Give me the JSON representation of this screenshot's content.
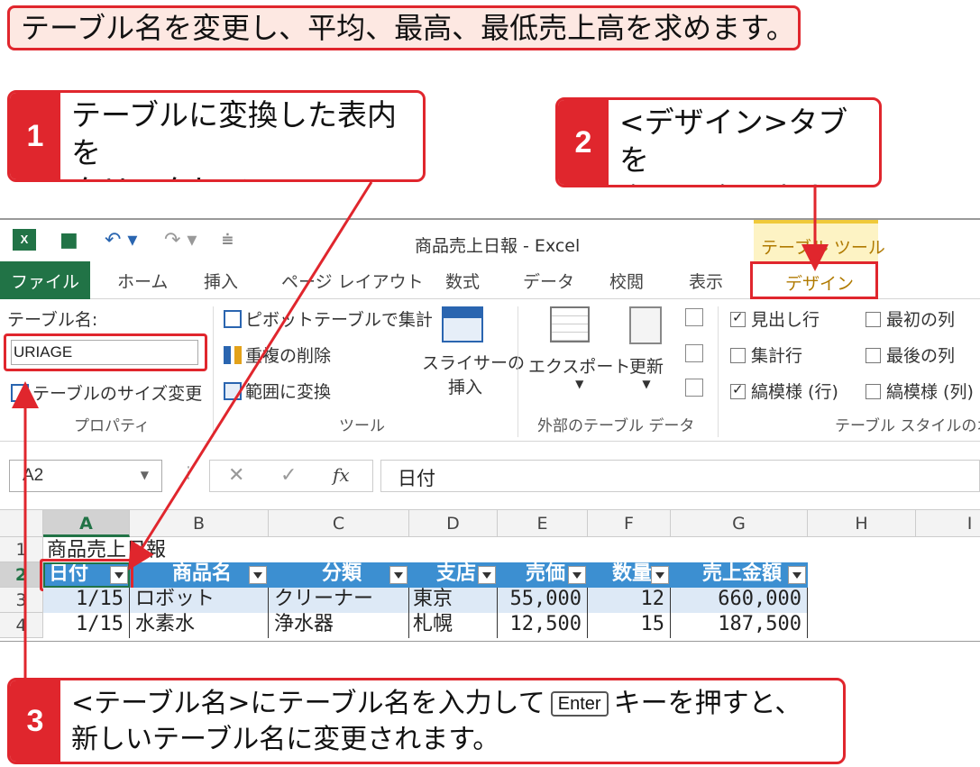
{
  "heading": "テーブル名を変更し、平均、最高、最低売上高を求めます。",
  "callouts": [
    {
      "num": "1",
      "text": "テーブルに変換した表内を\nクリックして、"
    },
    {
      "num": "2",
      "text": "<デザイン>タブを\nクリックします。"
    },
    {
      "num": "3",
      "text_before": "<テーブル名>にテーブル名を入力して",
      "key": "Enter",
      "text_after": "キーを押すと、\n新しいテーブル名に変更されます。"
    }
  ],
  "window": {
    "title": "商品売上日報 - Excel",
    "context_tab_group": "テーブル ツール",
    "tabs": [
      "ファイル",
      "ホーム",
      "挿入",
      "ページ レイアウト",
      "数式",
      "データ",
      "校閲",
      "表示",
      "デザイン"
    ]
  },
  "ribbon": {
    "table_name_label": "テーブル名:",
    "table_name_value": "URIAGE",
    "resize_table": "テーブルのサイズ変更",
    "group_properties": "プロパティ",
    "pivot": "ピボットテーブルで集計",
    "remove_duplicates": "重複の削除",
    "convert_range": "範囲に変換",
    "slicer_line1": "スライサーの",
    "slicer_line2": "挿入",
    "group_tools": "ツール",
    "export": "エクスポート",
    "refresh": "更新",
    "group_external": "外部のテーブル データ",
    "opt_header_row": "見出し行",
    "opt_total_row": "集計行",
    "opt_banded_rows": "縞模様 (行)",
    "opt_first_col": "最初の列",
    "opt_last_col": "最後の列",
    "opt_banded_cols": "縞模様 (列)",
    "group_style_options": "テーブル スタイルのオ",
    "header_row_checked": true,
    "total_row_checked": false,
    "banded_rows_checked": true,
    "first_col_checked": false,
    "last_col_checked": false,
    "banded_cols_checked": false
  },
  "formula_bar": {
    "name_box": "A2",
    "fx": "fx",
    "content": "日付"
  },
  "sheet": {
    "columns": [
      "A",
      "B",
      "C",
      "D",
      "E",
      "F",
      "G",
      "H",
      "I"
    ],
    "rows": [
      "1",
      "2",
      "3",
      "4"
    ],
    "title": "商品売上日報",
    "headers": [
      "日付",
      "商品名",
      "分類",
      "支店",
      "売価",
      "数量",
      "売上金額"
    ],
    "data": [
      [
        "1/15",
        "ロボット",
        "クリーナー",
        "東京",
        "55,000",
        "12",
        "660,000"
      ],
      [
        "1/15",
        "水素水",
        "浄水器",
        "札幌",
        "12,500",
        "15",
        "187,500"
      ]
    ]
  },
  "colors": {
    "accent": "#e0262d",
    "excel_green": "#217346",
    "table_header": "#3c8fd1",
    "band": "#dde9f6",
    "context_tab": "#fdf3c4"
  }
}
